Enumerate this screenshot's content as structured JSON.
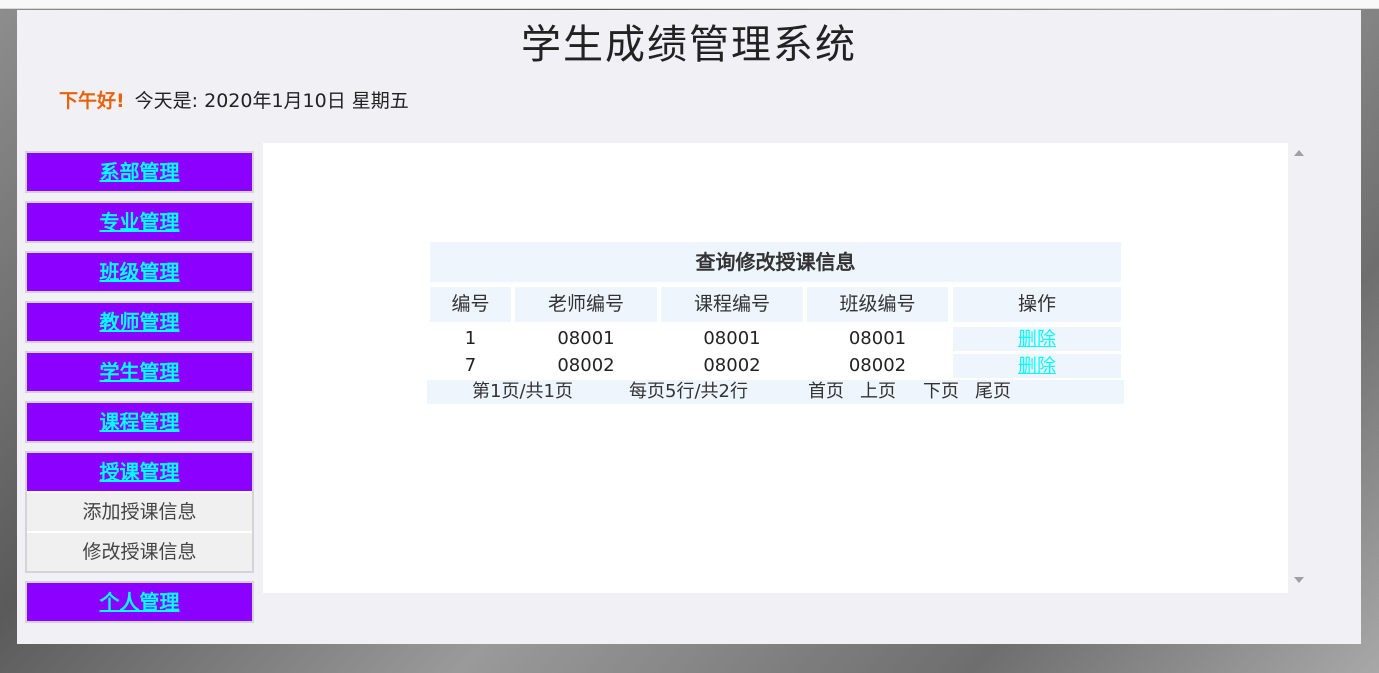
{
  "header": {
    "title": "学生成绩管理系统",
    "greeting": "下午好!",
    "date_text": "今天是: 2020年1月10日 星期五"
  },
  "sidebar": {
    "groups": [
      {
        "label": "系部管理"
      },
      {
        "label": "专业管理"
      },
      {
        "label": "班级管理"
      },
      {
        "label": "教师管理"
      },
      {
        "label": "学生管理"
      },
      {
        "label": "课程管理"
      },
      {
        "label": "授课管理",
        "sub_items": [
          "添加授课信息",
          "修改授课信息"
        ]
      },
      {
        "label": "个人管理"
      }
    ]
  },
  "table": {
    "caption": "查询修改授课信息",
    "columns": [
      "编号",
      "老师编号",
      "课程编号",
      "班级编号",
      "操作"
    ],
    "rows": [
      {
        "id": "1",
        "teacher_no": "08001",
        "course_no": "08001",
        "class_no": "08001",
        "action": "删除"
      },
      {
        "id": "7",
        "teacher_no": "08002",
        "course_no": "08002",
        "class_no": "08002",
        "action": "删除"
      }
    ]
  },
  "pager": {
    "page_info": "第1页/共1页",
    "row_info": "每页5行/共2行",
    "first": "首页",
    "prev": "上页",
    "next": "下页",
    "last": "尾页"
  },
  "colors": {
    "menu_bg": "#8b00ff",
    "menu_text": "#00ffff",
    "greeting": "#e8620c",
    "table_cell": "#eef5fd"
  }
}
